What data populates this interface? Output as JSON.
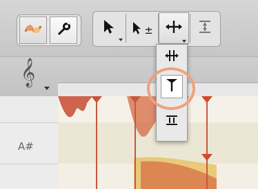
{
  "toolbar": {
    "main_tools": [
      "blob-tool-icon",
      "wrench-icon"
    ],
    "pointer_tools": [
      "pointer-tool-icon",
      "pointer-plus-tool-icon",
      "move-tool-icon",
      "separation-tool-icon"
    ],
    "pointer_plus_label": "±"
  },
  "dropdown": {
    "items": [
      "horizontal-move-icon",
      "tuning-fork-tool-icon",
      "equal-spacing-icon"
    ]
  },
  "clef": {
    "glyph": "𝄞"
  },
  "piano_roll": {
    "visible_key": "A#"
  },
  "colors": {
    "accent": "#f0a07c",
    "note_line": "#c8563d",
    "blob_fill": "#e8c56f"
  }
}
